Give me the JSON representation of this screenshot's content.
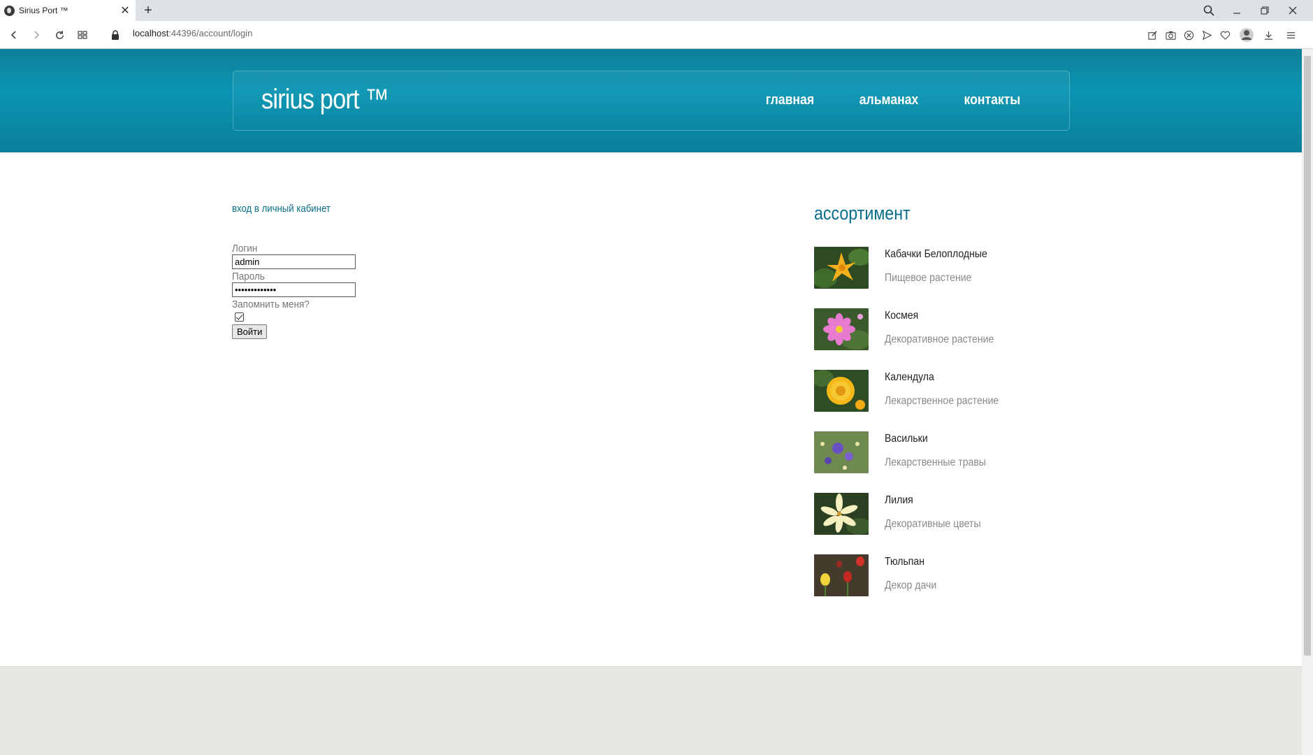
{
  "browser": {
    "tab_title": "Sirius Port ™",
    "url_host": "localhost",
    "url_rest": ":44396/account/login"
  },
  "header": {
    "logo": "sirius port ™",
    "nav": [
      "главная",
      "альманах",
      "контакты"
    ]
  },
  "login": {
    "title": "вход в личный кабинет",
    "login_label": "Логин",
    "login_value": "admin",
    "password_label": "Пароль",
    "password_value": "•••••••••••••",
    "remember_label": "Запомнить меня?",
    "submit_label": "Войти"
  },
  "assortment": {
    "title": "ассортимент",
    "items": [
      {
        "name": "Кабачки Белоплодные",
        "desc": "Пищевое растение"
      },
      {
        "name": "Космея",
        "desc": "Декоративное растение"
      },
      {
        "name": "Календула",
        "desc": "Лекарственное растение"
      },
      {
        "name": "Васильки",
        "desc": "Лекарственные травы"
      },
      {
        "name": "Лилия",
        "desc": "Декоративные цветы"
      },
      {
        "name": "Тюльпан",
        "desc": "Декор дачи"
      }
    ]
  }
}
